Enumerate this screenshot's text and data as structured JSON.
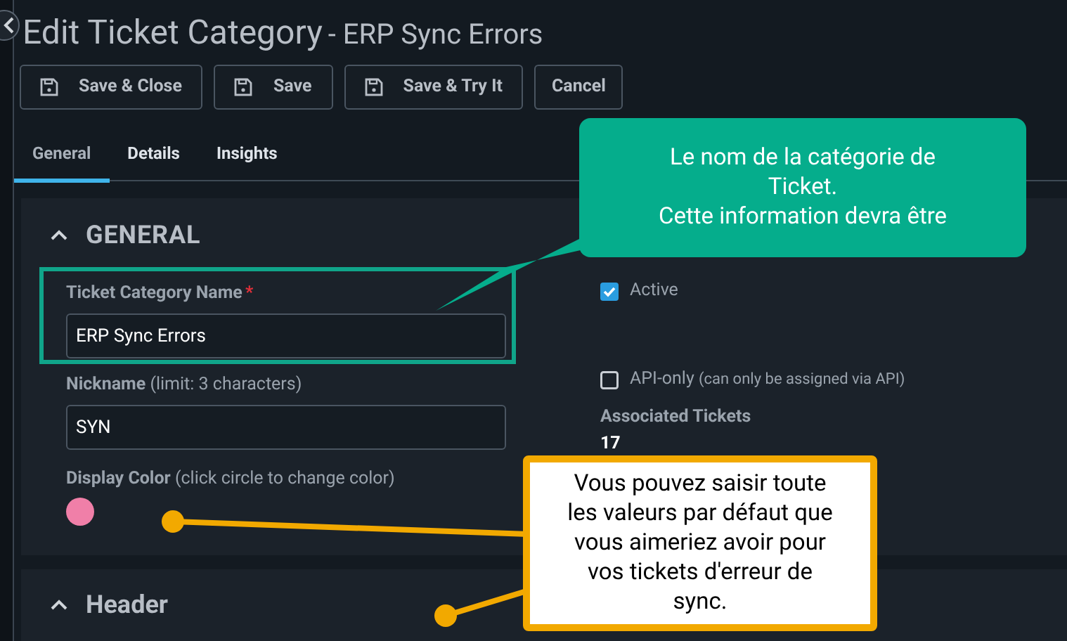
{
  "title": {
    "main": "Edit Ticket Category",
    "suffix": "- ERP Sync Errors"
  },
  "buttons": [
    {
      "label": "Save & Close",
      "icon": true
    },
    {
      "label": "Save",
      "icon": true
    },
    {
      "label": "Save & Try It",
      "icon": true
    },
    {
      "label": "Cancel",
      "icon": false
    }
  ],
  "tabs": [
    {
      "label": "General",
      "selected": true
    },
    {
      "label": "Details",
      "selected": false
    },
    {
      "label": "Insights",
      "selected": false
    }
  ],
  "general": {
    "heading": "GENERAL",
    "expanded": true,
    "name_field": {
      "label": "Ticket Category Name",
      "required_mark": "*",
      "value": "ERP Sync Errors"
    },
    "nickname": {
      "label": "Nickname",
      "hint": "(limit: 3 characters)",
      "value": "SYN"
    },
    "display_color": {
      "label": "Display Color",
      "hint": "(click circle to change color)",
      "color": "#f07fa8"
    },
    "active": {
      "label": "Active",
      "checked": true
    },
    "api_only": {
      "label": "API-only",
      "hint": "(can only be assigned via API)",
      "checked": false
    },
    "associated_tickets": {
      "label": "Associated Tickets",
      "value": "17"
    }
  },
  "header_section": {
    "heading": "Header",
    "expanded": true
  },
  "callouts": [
    {
      "kind": "green",
      "text": "Le nom de la catégorie de\nTicket.\nCette information devra être"
    },
    {
      "kind": "orange",
      "text": "Vous pouvez saisir toute\nles valeurs par défaut que\nvous aimeriez avoir pour\nvos tickets d'erreur de\nsync."
    }
  ]
}
